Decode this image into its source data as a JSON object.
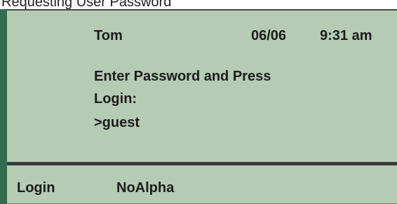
{
  "caption": "Requesting User Password",
  "status": {
    "user": "Tom",
    "date": "06/06",
    "time": "9:31 am"
  },
  "prompt": {
    "line1": "Enter Password and Press",
    "line2": "Login:",
    "entry": ">guest"
  },
  "softkeys": [
    {
      "label": "Login"
    },
    {
      "label": "NoAlpha"
    }
  ],
  "colors": {
    "screen_bg": "#b5cbb4",
    "left_bar": "#336b4e",
    "divider": "#3a3a3a"
  }
}
